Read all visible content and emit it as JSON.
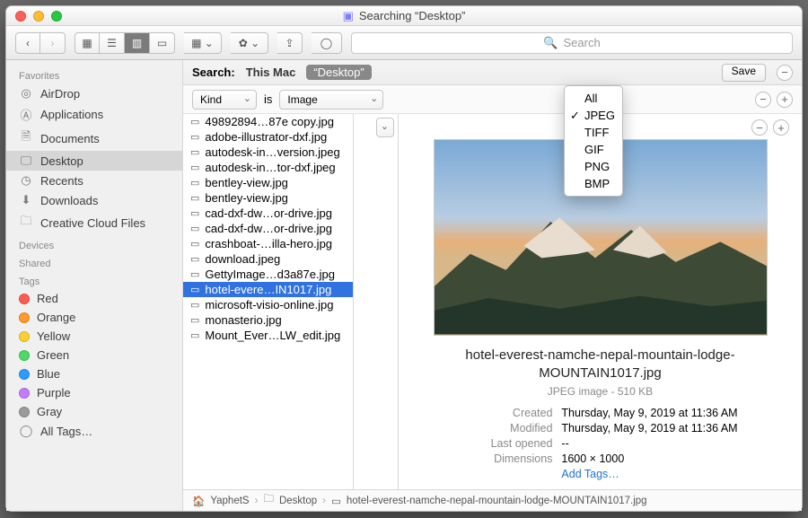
{
  "window": {
    "title": "Searching “Desktop”"
  },
  "search_placeholder": "Search",
  "sidebar": {
    "sections": [
      {
        "label": "Favorites",
        "items": [
          {
            "name": "AirDrop",
            "icon": "airdrop"
          },
          {
            "name": "Applications",
            "icon": "apps"
          },
          {
            "name": "Documents",
            "icon": "doc"
          },
          {
            "name": "Desktop",
            "icon": "desktop",
            "selected": true
          },
          {
            "name": "Recents",
            "icon": "clock"
          },
          {
            "name": "Downloads",
            "icon": "down"
          },
          {
            "name": "Creative Cloud Files",
            "icon": "folder"
          }
        ]
      },
      {
        "label": "Devices",
        "items": []
      },
      {
        "label": "Shared",
        "items": []
      },
      {
        "label": "Tags",
        "items": [
          {
            "name": "Red",
            "color": "#ff5a52"
          },
          {
            "name": "Orange",
            "color": "#ff9a2b"
          },
          {
            "name": "Yellow",
            "color": "#ffd02e"
          },
          {
            "name": "Green",
            "color": "#4cd964"
          },
          {
            "name": "Blue",
            "color": "#2b9cff"
          },
          {
            "name": "Purple",
            "color": "#c57bff"
          },
          {
            "name": "Gray",
            "color": "#9b9b9b"
          },
          {
            "name": "All Tags…",
            "color": null
          }
        ]
      }
    ]
  },
  "searchbar": {
    "label": "Search:",
    "scopes": [
      "This Mac",
      "“Desktop”"
    ],
    "active_scope": 1,
    "save_label": "Save"
  },
  "criteria": {
    "attr": "Kind",
    "op": "is",
    "value": "Image",
    "dropdown": [
      "All",
      "JPEG",
      "TIFF",
      "GIF",
      "PNG",
      "BMP"
    ],
    "dropdown_selected": 1
  },
  "files": [
    "49892894…87e copy.jpg",
    "adobe-illustrator-dxf.jpg",
    "autodesk-in…version.jpeg",
    "autodesk-in…tor-dxf.jpeg",
    "bentley-view.jpg",
    "bentley-view.jpg",
    "cad-dxf-dw…or-drive.jpg",
    "cad-dxf-dw…or-drive.jpg",
    "crashboat-…illa-hero.jpg",
    "download.jpeg",
    "GettyImage…d3a87e.jpg",
    "hotel-evere…IN1017.jpg",
    "microsoft-visio-online.jpg",
    "monasterio.jpg",
    "Mount_Ever…LW_edit.jpg"
  ],
  "selected_file_index": 11,
  "preview": {
    "filename": "hotel-everest-namche-nepal-mountain-lodge-MOUNTAIN1017.jpg",
    "kind": "JPEG image - 510 KB",
    "meta": {
      "Created": "Thursday, May 9, 2019 at 11:36 AM",
      "Modified": "Thursday, May 9, 2019 at 11:36 AM",
      "Last opened": "--",
      "Dimensions": "1600 × 1000"
    },
    "add_tags": "Add Tags…"
  },
  "pathbar": [
    "YaphetS",
    "Desktop",
    "hotel-everest-namche-nepal-mountain-lodge-MOUNTAIN1017.jpg"
  ]
}
